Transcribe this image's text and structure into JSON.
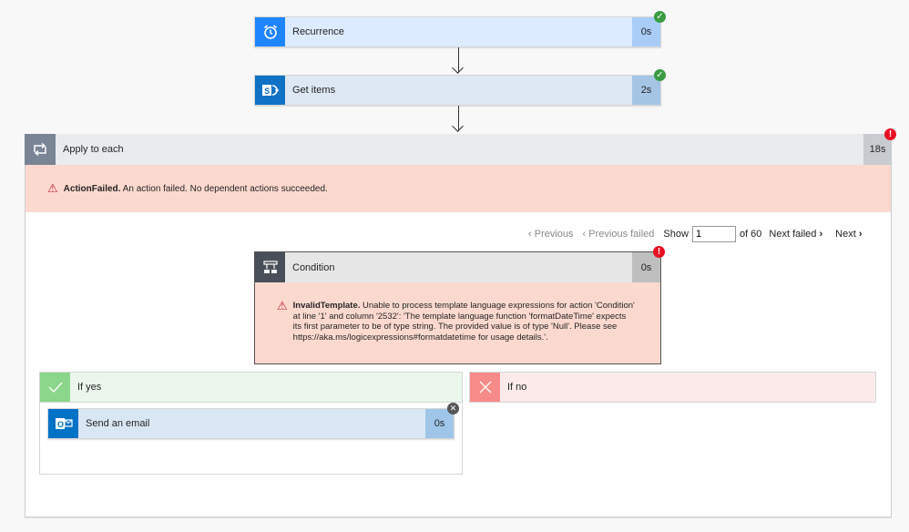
{
  "steps": {
    "recurrence": {
      "title": "Recurrence",
      "duration": "0s",
      "status": "succeeded",
      "icon": "alarm-clock-icon"
    },
    "get_items": {
      "title": "Get items",
      "duration": "2s",
      "status": "succeeded",
      "icon": "sharepoint-icon"
    }
  },
  "apply_each": {
    "title": "Apply to each",
    "duration": "18s",
    "status": "failed",
    "icon": "loop-icon",
    "error_code": "ActionFailed.",
    "error_message": " An action failed. No dependent actions succeeded."
  },
  "pager": {
    "previous": "Previous",
    "previous_failed": "Previous failed",
    "show_label": "Show",
    "current": "1",
    "of_total": "of 60",
    "next_failed": "Next failed",
    "next": "Next"
  },
  "condition": {
    "title": "Condition",
    "duration": "0s",
    "status": "failed",
    "icon": "condition-icon",
    "error_code": "InvalidTemplate.",
    "error_message": " Unable to process template language expressions for action 'Condition' at line '1' and column '2532': 'The template language function 'formatDateTime' expects its first parameter to be of type string. The provided value is of type 'Null'. Please see https://aka.ms/logicexpressions#formatdatetime for usage details.'."
  },
  "branches": {
    "yes": {
      "label": "If yes",
      "icon": "check-icon"
    },
    "no": {
      "label": "If no",
      "icon": "x-icon"
    }
  },
  "send_email": {
    "title": "Send an email",
    "duration": "0s",
    "status": "cancelled",
    "icon": "outlook-icon"
  },
  "colors": {
    "recurrence_icon": "#1f85ff",
    "sharepoint_icon": "#0f72c4",
    "loop_icon": "#798595",
    "condition_icon": "#484f58",
    "outlook_icon": "#0072c6",
    "error_bg": "#fcd9cf",
    "success": "#3a9b43",
    "failure": "#e81123"
  }
}
